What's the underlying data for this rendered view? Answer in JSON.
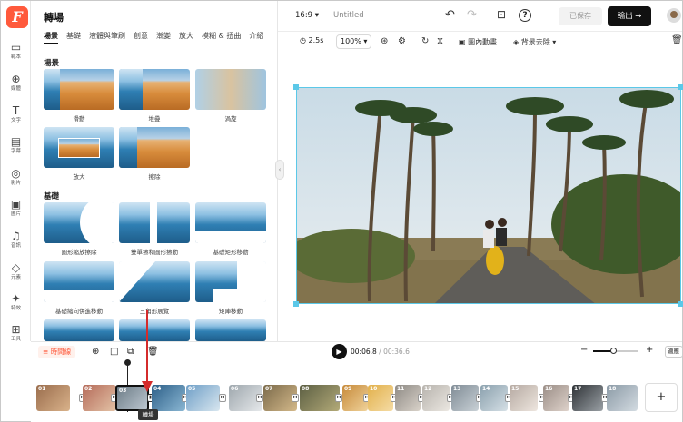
{
  "app": {
    "logo": "F"
  },
  "rail": [
    {
      "icon": "▭",
      "label": "範本"
    },
    {
      "icon": "⊕",
      "label": "媒體"
    },
    {
      "icon": "T",
      "label": "文字"
    },
    {
      "icon": "▤",
      "label": "字幕"
    },
    {
      "icon": "◎",
      "label": "影片"
    },
    {
      "icon": "▣",
      "label": "圖片"
    },
    {
      "icon": "♫",
      "label": "音訊"
    },
    {
      "icon": "◇",
      "label": "元素"
    },
    {
      "icon": "✦",
      "label": "特效"
    },
    {
      "icon": "⊞",
      "label": "工具"
    }
  ],
  "panel": {
    "title": "轉場",
    "tabs": [
      "場景",
      "基礎",
      "液體與筆刷",
      "創意",
      "漸變",
      "放大",
      "模糊 & 扭曲",
      "介紹"
    ],
    "section_scene": "場景",
    "section_basic": "基礎",
    "scene_items": [
      "滑動",
      "堆疊",
      "渦旋",
      "放大",
      "擦除"
    ],
    "basic_items": [
      "圓形縮放擦除",
      "雙單擦和圓形擦動",
      "基礎矩形移動",
      "基礎縮向併進移動",
      "三角形展覽",
      "矩陣移動"
    ]
  },
  "topbar": {
    "ratio": "16:9",
    "title": "Untitled",
    "saved": "已保存",
    "export": "輸出",
    "export_arrow": "→",
    "undo": "↶",
    "redo": "↷",
    "screenshot": "⊡",
    "help": "?"
  },
  "subbar": {
    "duration": "2.5s",
    "zoom": "100%",
    "anim": "圖內動畫",
    "bg_remove": "背景去除",
    "chev": "▾",
    "trash": "🗑"
  },
  "timeline": {
    "title": "時間線",
    "time_current": "00:06.8",
    "time_sep": " / ",
    "time_total": "00:36.6",
    "minus": "−",
    "plus": "+",
    "fit": "適應",
    "tooltip": "轉場",
    "add": "+",
    "clips": [
      "01",
      "02",
      "03",
      "04",
      "05",
      "06",
      "07",
      "08",
      "09",
      "10",
      "11",
      "12",
      "13",
      "14",
      "15",
      "16",
      "17",
      "18"
    ]
  },
  "colors": {
    "accent": "#ff5a3c",
    "select": "#5bc8e8",
    "arrow": "#d42b2b"
  }
}
